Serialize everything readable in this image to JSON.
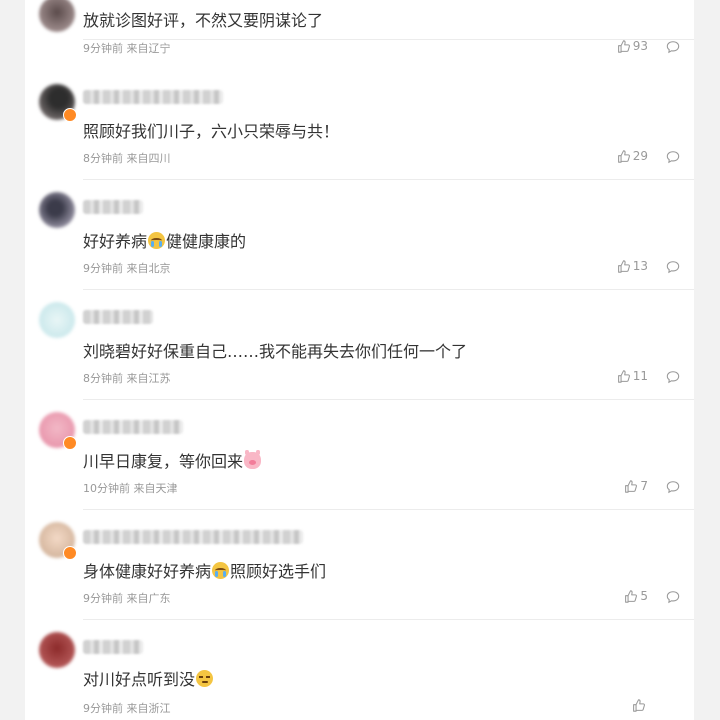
{
  "comments": [
    {
      "text": "放就诊图好评，不然又要阴谋论了",
      "meta": "9分钟前 来自辽宁",
      "likes": "93"
    },
    {
      "text": "照顾好我们川子，六小只荣辱与共！",
      "meta": "8分钟前 来自四川",
      "likes": "29"
    },
    {
      "text_before": "好好养病",
      "emoji": "crying-face",
      "text_after": "健健康康的",
      "meta": "9分钟前 来自北京",
      "likes": "13"
    },
    {
      "text": "刘晓碧好好保重自己……我不能再失去你们任何一个了",
      "meta": "8分钟前 来自江苏",
      "likes": "11"
    },
    {
      "text_before": "川早日康复，等你回来",
      "emoji": "pig-face",
      "text_after": "",
      "meta": "10分钟前 来自天津",
      "likes": "7"
    },
    {
      "text_before": "身体健康好好养病",
      "emoji": "crying-face",
      "text_after": "照顾好选手们",
      "meta": "9分钟前 来自广东",
      "likes": "5"
    },
    {
      "text_before": "对川好点听到没",
      "emoji": "smug-face",
      "text_after": "",
      "meta": "9分钟前 来自浙江",
      "likes": ""
    }
  ],
  "colors": {
    "accent_badge": "#ff8a24",
    "text": "#333333",
    "meta": "#999999",
    "background": "#f2f2f2"
  }
}
